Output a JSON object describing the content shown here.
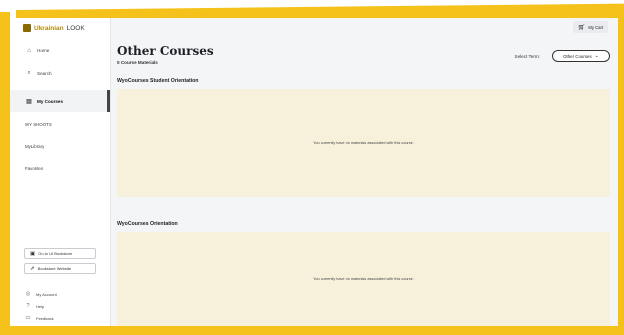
{
  "sidebar": {
    "logo": {
      "brand": "Ukrainian",
      "suffix": "LOOK"
    },
    "nav": [
      {
        "icon": "home-icon",
        "glyph": "⌂",
        "label": "Home"
      },
      {
        "icon": "search-icon",
        "glyph": "⌕",
        "label": "Search"
      },
      {
        "icon": "book-icon",
        "glyph": "▤",
        "label": "My Courses"
      }
    ],
    "links": [
      "WY SHOOTS",
      "MyLibrary",
      "Favorites"
    ],
    "buttons": [
      {
        "icon": "bookstore-icon",
        "glyph": "▣",
        "label": "Go to UI Bookstore"
      },
      {
        "icon": "external-link-icon",
        "glyph": "⇗",
        "label": "Bookstore Website"
      }
    ],
    "footer": [
      {
        "icon": "user-icon",
        "glyph": "◎",
        "label": "My Account"
      },
      {
        "icon": "help-icon",
        "glyph": "?",
        "label": "Help"
      },
      {
        "icon": "feedback-icon",
        "glyph": "▭",
        "label": "Feedback"
      }
    ]
  },
  "header": {
    "cart_label": "My Cart",
    "cart_icon": "cart-icon"
  },
  "main": {
    "title": "Other Courses",
    "subtitle": "0 Course Materials",
    "term_label": "Select Term:",
    "term_value": "Other Courses",
    "sections": [
      {
        "title": "WyoCourses Student Orientation",
        "message": "You currently have no materials associated with this course."
      },
      {
        "title": "WyoCourses Orientation",
        "message": "You currently have no materials associated with this course."
      }
    ]
  },
  "colors": {
    "frame": "#f4c21a",
    "empty_box": "#f7f1dc",
    "main_bg": "#f3f5f7"
  }
}
